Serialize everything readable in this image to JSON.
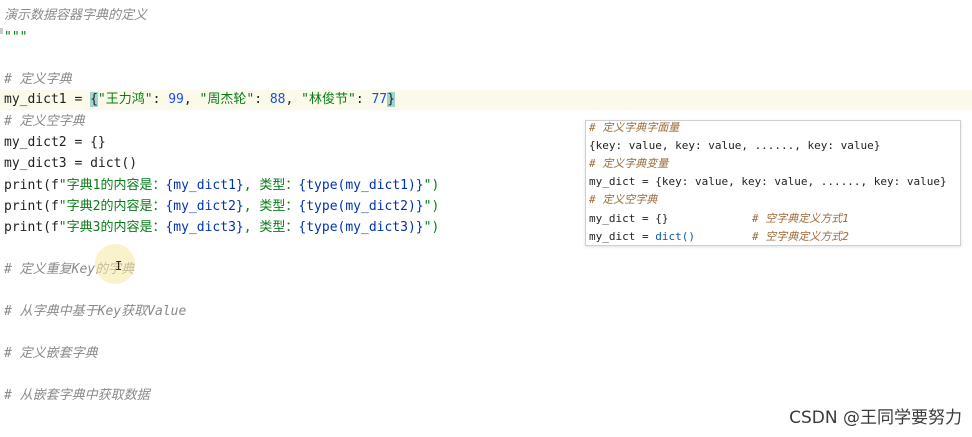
{
  "editor": {
    "docstring_title": "演示数据容器字典的定义",
    "docstring_close": "\"\"\"",
    "comment_define": "# 定义字典",
    "line_dict1_pre": "my_dict1 = ",
    "brace_open": "{",
    "s1": "\"王力鸿\"",
    "colon1": ": ",
    "n1": "99",
    "sep1": ", ",
    "s2": "\"周杰轮\"",
    "colon2": ": ",
    "n2": "88",
    "sep2": ", ",
    "s3": "\"林俊节\"",
    "colon3": ": ",
    "n3": "77",
    "brace_close": "}",
    "comment_empty": "# 定义空字典",
    "line_dict2": "my_dict2 = {}",
    "line_dict3": "my_dict3 = dict()",
    "print1_a": "print(f",
    "print1_b": "\"字典1的内容是：",
    "print1_c": "{my_dict1}",
    "print1_d": ", 类型：",
    "print1_e": "{type(my_dict1)}",
    "print1_f": "\")",
    "print2_a": "print(f",
    "print2_b": "\"字典2的内容是：",
    "print2_c": "{my_dict2}",
    "print2_d": ", 类型：",
    "print2_e": "{type(my_dict2)}",
    "print2_f": "\")",
    "print3_a": "print(f",
    "print3_b": "\"字典3的内容是：",
    "print3_c": "{my_dict3}",
    "print3_d": ", 类型：",
    "print3_e": "{type(my_dict3)}",
    "print3_f": "\")",
    "comment_dup_key": "# 定义重复Key的字典",
    "comment_get_value": "# 从字典中基于Key获取Value",
    "comment_nested": "# 定义嵌套字典",
    "comment_nested_get": "# 从嵌套字典中获取数据"
  },
  "popup": {
    "c1": "# 定义字典字面量",
    "l1": "{key: value, key: value, ......, key: value}",
    "c2": "# 定义字典变量",
    "l2": "my_dict = {key: value, key: value, ......, key: value}",
    "c3": "# 定义空字典",
    "l3_code": "my_dict = {}",
    "l3_comment": "# 空字典定义方式1",
    "l4_pre": "my_dict = ",
    "l4_fn": "dict()",
    "l4_comment": "# 空字典定义方式2"
  },
  "watermark": "CSDN @王同学要努力"
}
